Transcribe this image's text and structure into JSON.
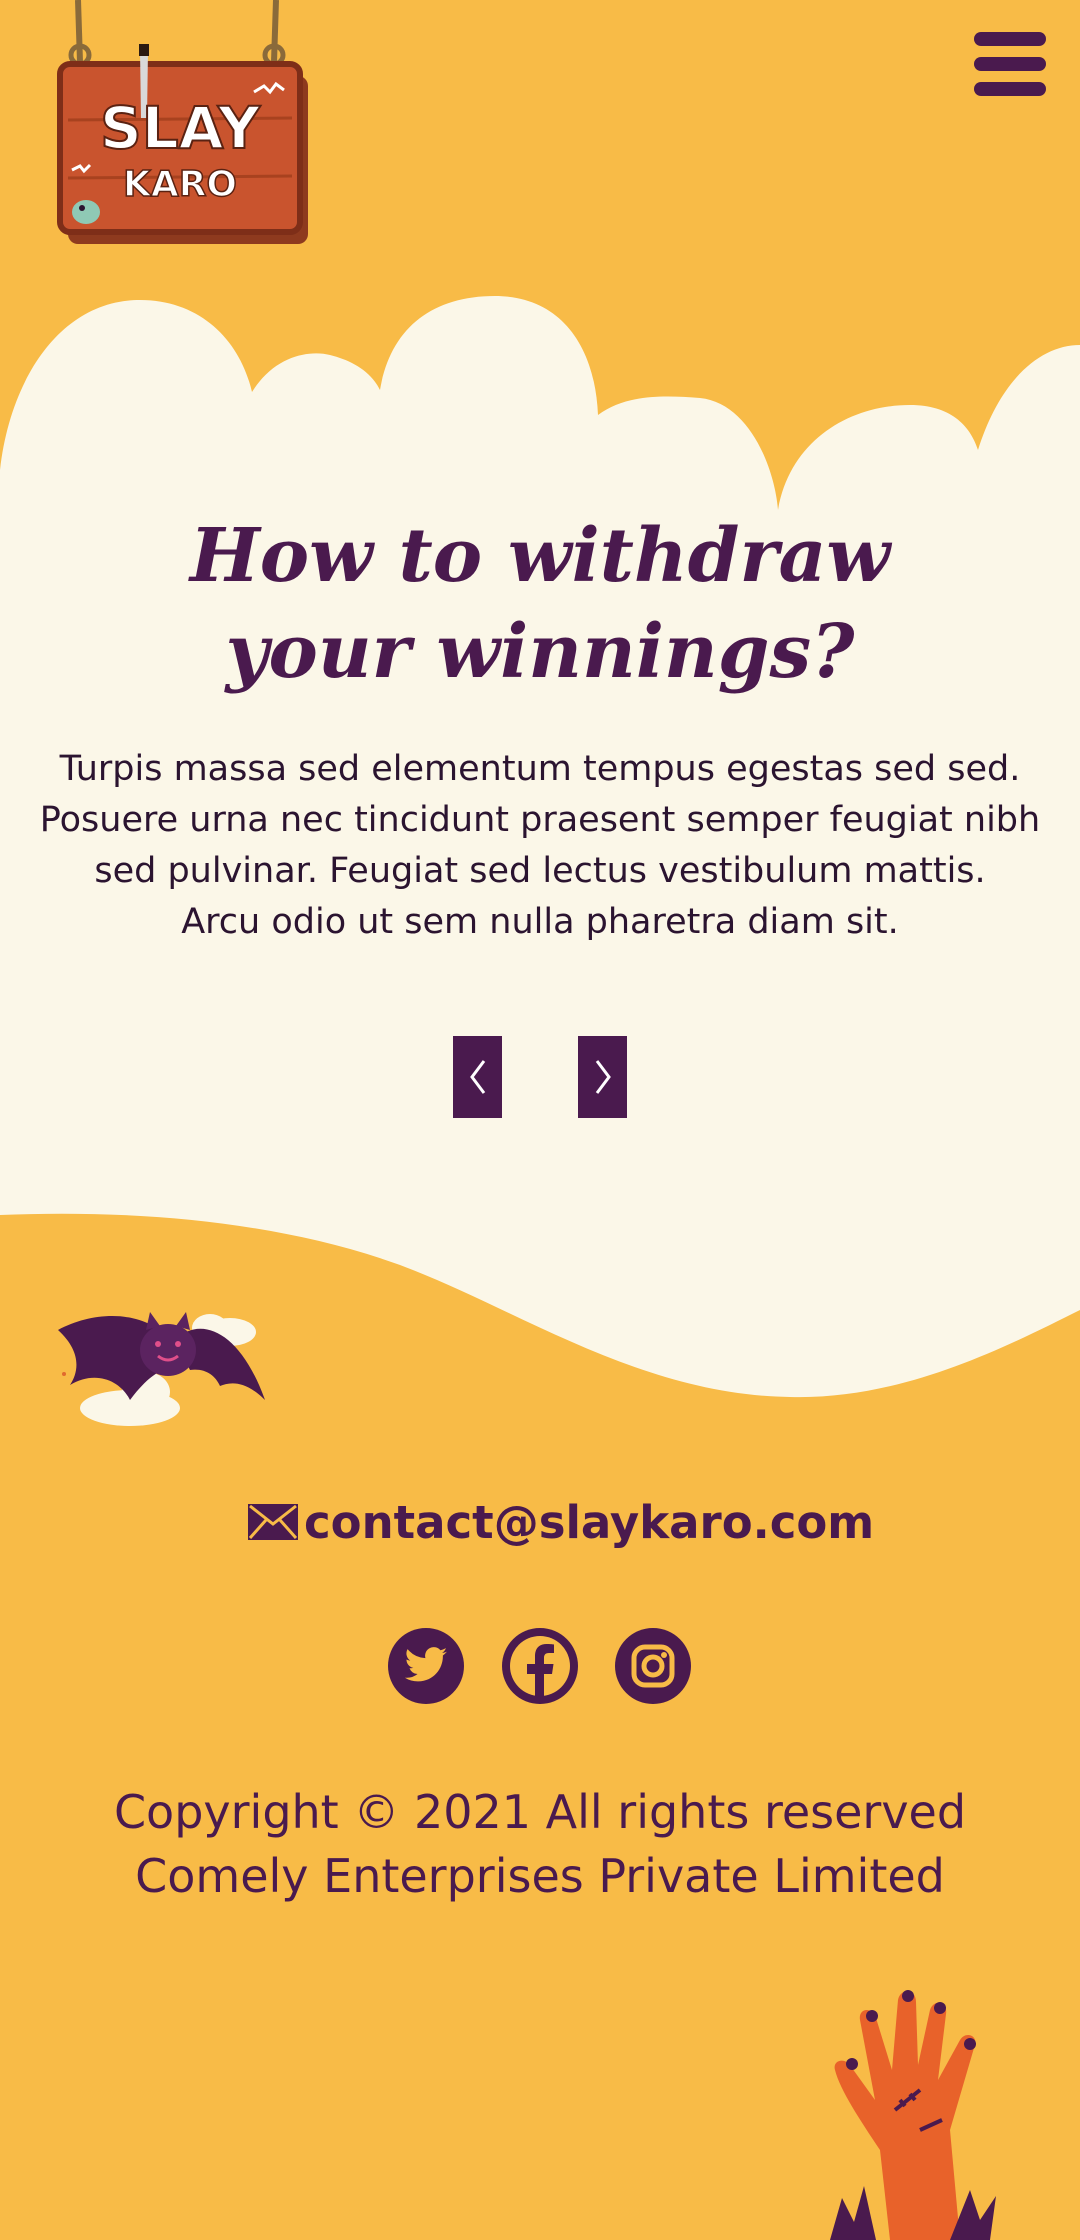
{
  "header": {
    "logo_line1": "SLAY",
    "logo_line2": "KARO",
    "menu_icon": "hamburger-menu-icon"
  },
  "hero": {
    "title_line1": "How to withdraw",
    "title_line2": "your winnings?",
    "paragraph_lines": [
      "Turpis massa sed elementum tempus egestas sed sed.",
      "Posuere urna nec tincidunt praesent semper feugiat nibh",
      "sed pulvinar. Feugiat sed lectus vestibulum mattis.",
      "Arcu odio ut sem nulla pharetra diam sit."
    ],
    "prev_icon": "chevron-left-icon",
    "next_icon": "chevron-right-icon"
  },
  "footer": {
    "email_icon": "envelope-icon",
    "email": "contact@slaykaro.com",
    "social": [
      {
        "name": "twitter",
        "icon": "twitter-icon"
      },
      {
        "name": "facebook",
        "icon": "facebook-icon"
      },
      {
        "name": "instagram",
        "icon": "instagram-icon"
      }
    ],
    "copyright_line1": "Copyright © 2021 All rights reserved",
    "copyright_line2": "Comely Enterprises Private Limited"
  },
  "colors": {
    "background": "#F8BB47",
    "cream": "#FBF7E8",
    "primary": "#4A1A4E",
    "sign_wood": "#C9542E"
  }
}
